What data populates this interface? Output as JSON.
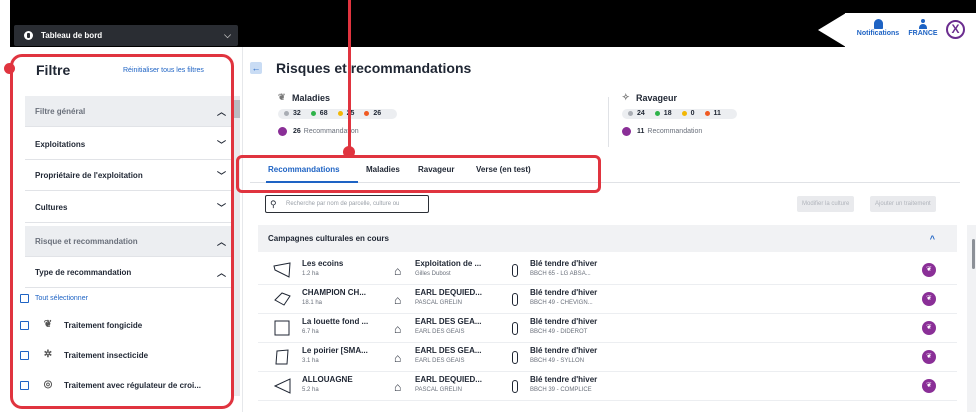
{
  "header": {
    "dashboard_label": "Tableau de bord",
    "notifications_label": "Notifications",
    "country_label": "FRANCE",
    "close_label": "X"
  },
  "sidebar": {
    "title": "Filtre",
    "reset_label": "Réinitialiser tous les filtres",
    "rows": [
      {
        "label": "Filtre général",
        "group": true,
        "chevron": "^"
      },
      {
        "label": "Exploitations",
        "group": false,
        "chevron": "v"
      },
      {
        "label": "Propriétaire de l'exploitation",
        "group": false,
        "chevron": "v"
      },
      {
        "label": "Cultures",
        "group": false,
        "chevron": "v"
      },
      {
        "label": "Risque et recommandation",
        "group": true,
        "chevron": "^"
      },
      {
        "label": "Type de recommandation",
        "group": false,
        "chevron": "^"
      }
    ],
    "select_all_label": "Tout sélectionner",
    "options": [
      {
        "label": "Traitement fongicide",
        "icon": "fungicide-icon"
      },
      {
        "label": "Traitement insecticide",
        "icon": "insecticide-icon"
      },
      {
        "label": "Traitement avec régulateur de croi...",
        "icon": "regulator-icon"
      }
    ]
  },
  "main": {
    "title": "Risques et recommandations",
    "cards": [
      {
        "title": "Maladies",
        "icon": "leaf-icon",
        "counts": [
          {
            "value": "32",
            "color": "#a9adb4"
          },
          {
            "value": "68",
            "color": "#2fb34a"
          },
          {
            "value": "25",
            "color": "#f2b705"
          },
          {
            "value": "26",
            "color": "#f05a22"
          }
        ],
        "reco_count": "26",
        "reco_label": "Recommandation"
      },
      {
        "title": "Ravageur",
        "icon": "bug-icon",
        "counts": [
          {
            "value": "24",
            "color": "#a9adb4"
          },
          {
            "value": "18",
            "color": "#2fb34a"
          },
          {
            "value": "0",
            "color": "#f2b705"
          },
          {
            "value": "11",
            "color": "#f05a22"
          }
        ],
        "reco_count": "11",
        "reco_label": "Recommandation"
      }
    ],
    "tabs": [
      "Recommandations",
      "Maladies",
      "Ravageur",
      "Verse (en test)"
    ],
    "active_tab": "Recommandations",
    "search_placeholder": "Recherche par nom de parcelle, culture ou",
    "buttons": {
      "modify_crop": "Modifier la culture",
      "add_treatment": "Ajouter un traitement"
    },
    "section_title": "Campagnes culturales en cours",
    "rows": [
      {
        "parcel": "Les ecoins",
        "area": "1.2 ha",
        "farm": "Exploitation de ...",
        "owner": "Gilles Dubost",
        "crop": "Blé tendre d'hiver",
        "stage": "BBCH 65 - LG ABSA..."
      },
      {
        "parcel": "CHAMPION CH...",
        "area": "18.1 ha",
        "farm": "EARL DEQUIED...",
        "owner": "PASCAL GRELIN",
        "crop": "Blé tendre d'hiver",
        "stage": "BBCH 49 - CHEVIGN..."
      },
      {
        "parcel": "La louette fond ...",
        "area": "6.7 ha",
        "farm": "EARL DES GEA...",
        "owner": "EARL DES GEAIS",
        "crop": "Blé tendre d'hiver",
        "stage": "BBCH 49 - DIDEROT"
      },
      {
        "parcel": "Le poirier [SMA...",
        "area": "3.1 ha",
        "farm": "EARL DES GEA...",
        "owner": "EARL DES GEAIS",
        "crop": "Blé tendre d'hiver",
        "stage": "BBCH 49 - SYLLON"
      },
      {
        "parcel": "ALLOUAGNE",
        "area": "5.2 ha",
        "farm": "EARL DEQUIED...",
        "owner": "PASCAL GRELIN",
        "crop": "Blé tendre d'hiver",
        "stage": "BBCH 39 - COMPLICE"
      }
    ]
  },
  "colors": {
    "accent": "#1e63c4",
    "highlight": "#e0343f",
    "recommendation": "#8a2f97"
  }
}
